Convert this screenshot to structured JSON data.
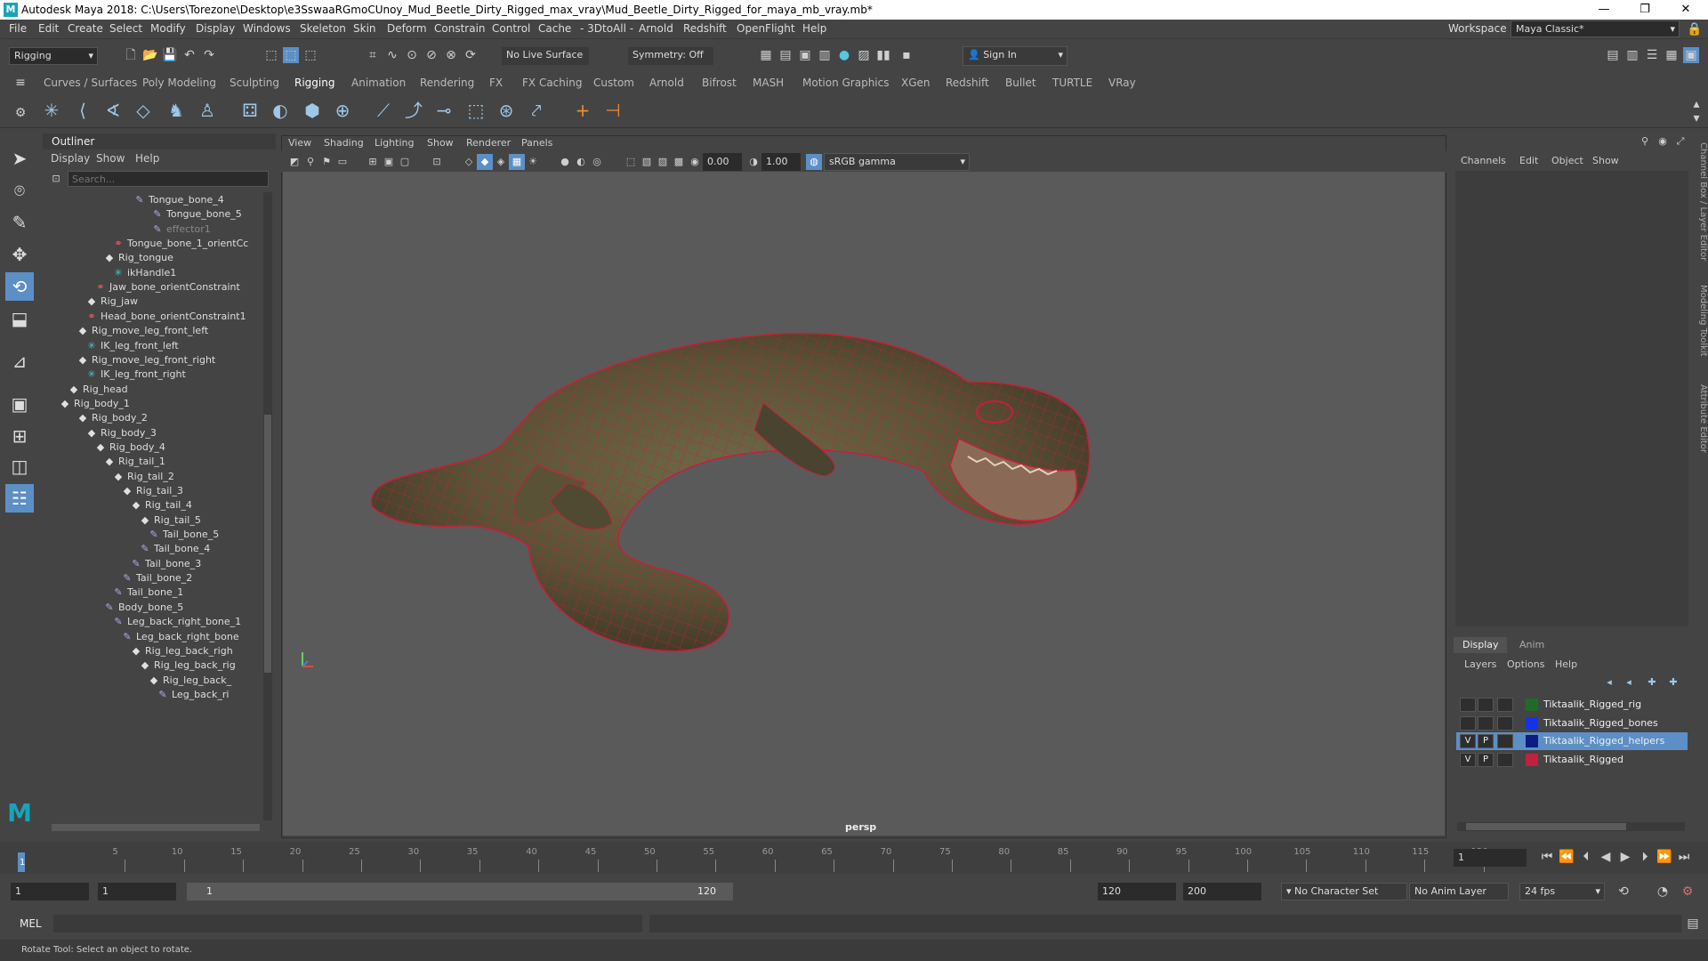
{
  "titlebar": {
    "title": "Autodesk Maya 2018: C:\\Users\\Torezone\\Desktop\\e3SswaaRGmoCUnoy_Mud_Beetle_Dirty_Rigged_max_vray\\Mud_Beetle_Dirty_Rigged_for_maya_mb_vray.mb*",
    "minimize": "—",
    "restore": "❐",
    "close": "✕"
  },
  "menus": [
    "File",
    "Edit",
    "Create",
    "Select",
    "Modify",
    "Display",
    "Windows",
    "Skeleton",
    "Skin",
    "Deform",
    "Constrain",
    "Control",
    "Cache",
    "- 3DtoAll -",
    "Arnold",
    "Redshift",
    "OpenFlight",
    "Help"
  ],
  "workspace": {
    "label": "Workspace :",
    "value": "Maya Classic*"
  },
  "status": {
    "mode": "Rigging",
    "live_surface": "No Live Surface",
    "symmetry": "Symmetry: Off",
    "sign_in": "Sign In"
  },
  "shelf_tabs": [
    "Curves / Surfaces",
    "Poly Modeling",
    "Sculpting",
    "Rigging",
    "Animation",
    "Rendering",
    "FX",
    "FX Caching",
    "Custom",
    "Arnold",
    "Bifrost",
    "MASH",
    "Motion Graphics",
    "XGen",
    "Redshift",
    "Bullet",
    "TURTLE",
    "VRay"
  ],
  "shelf_active": "Rigging",
  "outliner": {
    "title": "Outliner",
    "menu": [
      "Display",
      "Show",
      "Help"
    ],
    "search_placeholder": "Search...",
    "rows": [
      {
        "label": "Tongue_bone_4",
        "type": "joint"
      },
      {
        "label": "Tongue_bone_5",
        "type": "joint"
      },
      {
        "label": "effector1",
        "type": "joint"
      },
      {
        "label": "Tongue_bone_1_orientCc",
        "type": "constraint"
      },
      {
        "label": "Rig_tongue",
        "type": "group"
      },
      {
        "label": "ikHandle1",
        "type": "ik"
      },
      {
        "label": "Jaw_bone_orientConstraint",
        "type": "constraint"
      },
      {
        "label": "Rig_jaw",
        "type": "group"
      },
      {
        "label": "Head_bone_orientConstraint1",
        "type": "constraint"
      },
      {
        "label": "Rig_move_leg_front_left",
        "type": "group"
      },
      {
        "label": "IK_leg_front_left",
        "type": "ik"
      },
      {
        "label": "Rig_move_leg_front_right",
        "type": "group"
      },
      {
        "label": "IK_leg_front_right",
        "type": "ik"
      },
      {
        "label": "Rig_head",
        "type": "group"
      },
      {
        "label": "Rig_body_1",
        "type": "group"
      },
      {
        "label": "Rig_body_2",
        "type": "group"
      },
      {
        "label": "Rig_body_3",
        "type": "group"
      },
      {
        "label": "Rig_body_4",
        "type": "group"
      },
      {
        "label": "Rig_tail_1",
        "type": "group"
      },
      {
        "label": "Rig_tail_2",
        "type": "group"
      },
      {
        "label": "Rig_tail_3",
        "type": "group"
      },
      {
        "label": "Rig_tail_4",
        "type": "group"
      },
      {
        "label": "Rig_tail_5",
        "type": "group"
      },
      {
        "label": "Tail_bone_5",
        "type": "joint"
      },
      {
        "label": "Tail_bone_4",
        "type": "joint"
      },
      {
        "label": "Tail_bone_3",
        "type": "joint"
      },
      {
        "label": "Tail_bone_2",
        "type": "joint"
      },
      {
        "label": "Tail_bone_1",
        "type": "joint"
      },
      {
        "label": "Body_bone_5",
        "type": "joint"
      },
      {
        "label": "Leg_back_right_bone_1",
        "type": "joint"
      },
      {
        "label": "Leg_back_right_bone",
        "type": "joint"
      },
      {
        "label": "Rig_leg_back_righ",
        "type": "group"
      },
      {
        "label": "Rig_leg_back_rig",
        "type": "group"
      },
      {
        "label": "Rig_leg_back_",
        "type": "group"
      },
      {
        "label": "Leg_back_ri",
        "type": "joint"
      }
    ]
  },
  "viewport": {
    "menu": [
      "View",
      "Shading",
      "Lighting",
      "Show",
      "Renderer",
      "Panels"
    ],
    "field_a": "0.00",
    "field_b": "1.00",
    "colorspace": "sRGB gamma",
    "camera": "persp"
  },
  "channel_box": {
    "menu": [
      "Channels",
      "Edit",
      "Object",
      "Show"
    ]
  },
  "side_tabs": [
    "Channel Box / Layer Editor",
    "Modeling Toolkit",
    "Attribute Editor"
  ],
  "layer_editor": {
    "tabs": [
      "Display",
      "Anim"
    ],
    "menu": [
      "Layers",
      "Options",
      "Help"
    ],
    "layers": [
      {
        "name": "Tiktaalik_Rigged_rig",
        "v": "",
        "p": "",
        "color": "#1f6b2a",
        "selected": false
      },
      {
        "name": "Tiktaalik_Rigged_bones",
        "v": "",
        "p": "",
        "color": "#1432e8",
        "selected": false
      },
      {
        "name": "Tiktaalik_Rigged_helpers",
        "v": "V",
        "p": "P",
        "color": "#0b1d82",
        "selected": true
      },
      {
        "name": "Tiktaalik_Rigged",
        "v": "V",
        "p": "P",
        "color": "#c0213c",
        "selected": false
      }
    ]
  },
  "timeline": {
    "ticks": [
      "5",
      "10",
      "15",
      "20",
      "25",
      "30",
      "35",
      "40",
      "45",
      "50",
      "55",
      "60",
      "65",
      "70",
      "75",
      "80",
      "85",
      "90",
      "95",
      "100",
      "105",
      "110",
      "115",
      "120"
    ],
    "current": "1",
    "frame_field": "1"
  },
  "range": {
    "start": "1",
    "anim_start": "1",
    "slider_start": "1",
    "slider_end": "120",
    "end": "120",
    "anim_end": "200",
    "character_set": "No Character Set",
    "anim_layer": "No Anim Layer",
    "fps": "24 fps"
  },
  "cmdline": {
    "label": "MEL"
  },
  "help": {
    "text": "Rotate Tool: Select an object to rotate."
  },
  "colors": {
    "accent": "#5c8fc5",
    "wire": "#c81e3a",
    "selected_layer": "#5c8fc5"
  }
}
